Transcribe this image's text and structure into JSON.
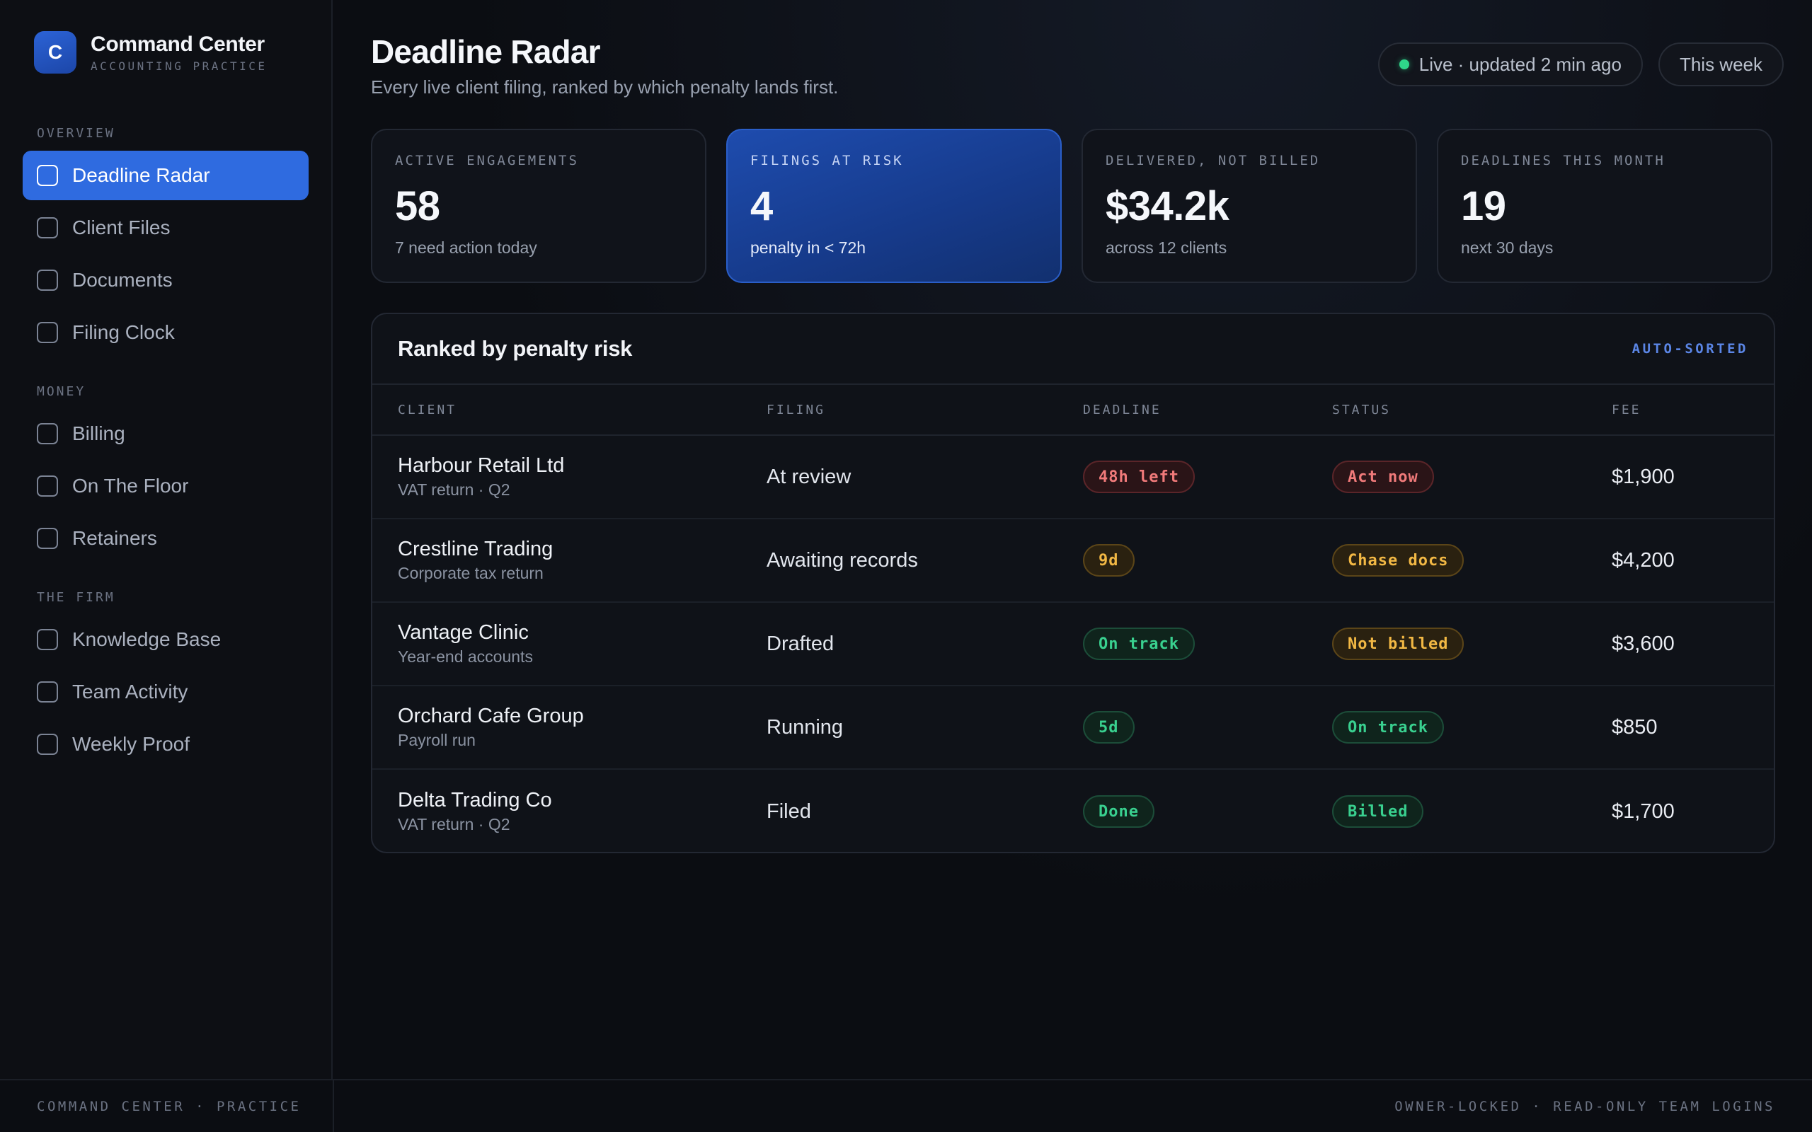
{
  "brand": {
    "logo_letter": "C",
    "title": "Command Center",
    "subtitle": "ACCOUNTING PRACTICE"
  },
  "sidebar": {
    "sections": [
      {
        "label": "OVERVIEW",
        "items": [
          {
            "label": "Deadline Radar",
            "active": true
          },
          {
            "label": "Client Files",
            "active": false
          },
          {
            "label": "Documents",
            "active": false
          },
          {
            "label": "Filing Clock",
            "active": false
          }
        ]
      },
      {
        "label": "MONEY",
        "items": [
          {
            "label": "Billing",
            "active": false
          },
          {
            "label": "On The Floor",
            "active": false
          },
          {
            "label": "Retainers",
            "active": false
          }
        ]
      },
      {
        "label": "THE FIRM",
        "items": [
          {
            "label": "Knowledge Base",
            "active": false
          },
          {
            "label": "Team Activity",
            "active": false
          },
          {
            "label": "Weekly Proof",
            "active": false
          }
        ]
      }
    ]
  },
  "header": {
    "title": "Deadline Radar",
    "subtitle": "Every live client filing, ranked by which penalty lands first.",
    "live_status": "Live · updated 2 min ago",
    "range_button": "This week",
    "live_color": "#2fd68a"
  },
  "stats": [
    {
      "label": "ACTIVE ENGAGEMENTS",
      "value": "58",
      "sub": "7 need action today",
      "highlight": false
    },
    {
      "label": "FILINGS AT RISK",
      "value": "4",
      "sub": "penalty in < 72h",
      "highlight": true
    },
    {
      "label": "DELIVERED, NOT BILLED",
      "value": "$34.2k",
      "sub": "across 12 clients",
      "highlight": false
    },
    {
      "label": "DEADLINES THIS MONTH",
      "value": "19",
      "sub": "next 30 days",
      "highlight": false
    }
  ],
  "table": {
    "title": "Ranked by penalty risk",
    "sort_label": "AUTO-SORTED",
    "columns": [
      "CLIENT",
      "FILING",
      "DEADLINE",
      "STATUS",
      "FEE"
    ],
    "rows": [
      {
        "client": "Harbour Retail Ltd",
        "client_sub": "VAT return · Q2",
        "filing": "At review",
        "deadline": "48h left",
        "deadline_tone": "red",
        "status": "Act now",
        "status_tone": "red",
        "fee": "$1,900"
      },
      {
        "client": "Crestline Trading",
        "client_sub": "Corporate tax return",
        "filing": "Awaiting records",
        "deadline": "9d",
        "deadline_tone": "amber",
        "status": "Chase docs",
        "status_tone": "amber",
        "fee": "$4,200"
      },
      {
        "client": "Vantage Clinic",
        "client_sub": "Year-end accounts",
        "filing": "Drafted",
        "deadline": "On track",
        "deadline_tone": "green",
        "status": "Not billed",
        "status_tone": "amber",
        "fee": "$3,600"
      },
      {
        "client": "Orchard Cafe Group",
        "client_sub": "Payroll run",
        "filing": "Running",
        "deadline": "5d",
        "deadline_tone": "green",
        "status": "On track",
        "status_tone": "green",
        "fee": "$850"
      },
      {
        "client": "Delta Trading Co",
        "client_sub": "VAT return · Q2",
        "filing": "Filed",
        "deadline": "Done",
        "deadline_tone": "green",
        "status": "Billed",
        "status_tone": "green",
        "fee": "$1,700"
      }
    ]
  },
  "footer": {
    "left": "COMMAND CENTER · PRACTICE",
    "right": "OWNER-LOCKED · READ-ONLY TEAM LOGINS"
  },
  "colors": {
    "accent": "#2f6be0",
    "red": "#f07a7a",
    "amber": "#f2b844",
    "green": "#39d08f"
  }
}
